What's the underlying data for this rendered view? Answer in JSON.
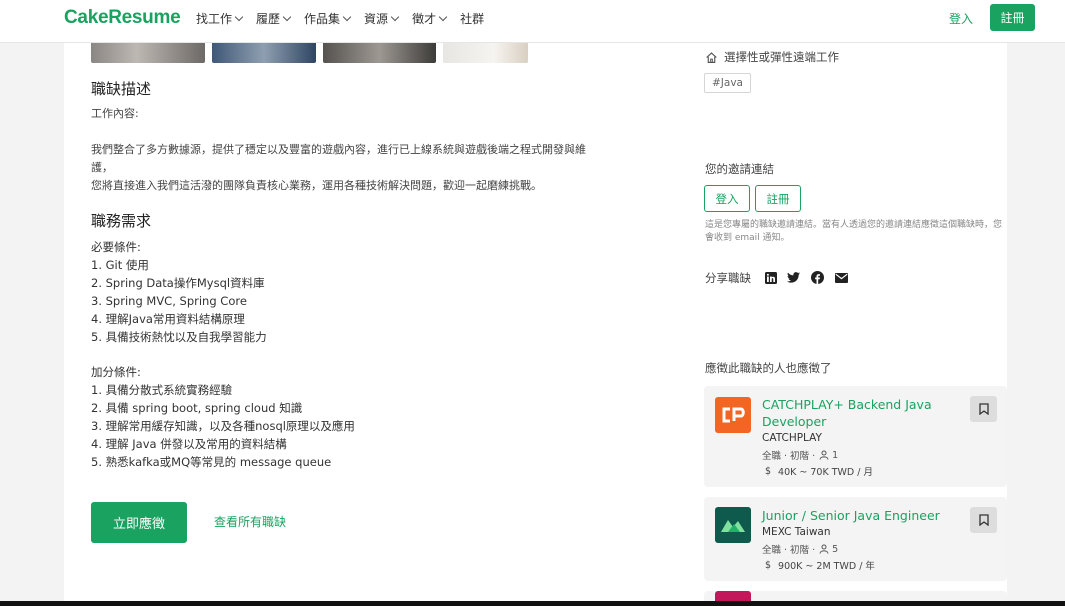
{
  "header": {
    "logo": "CakeResume",
    "nav": [
      {
        "label": "找工作",
        "has_menu": true
      },
      {
        "label": "履歷",
        "has_menu": true
      },
      {
        "label": "作品集",
        "has_menu": true
      },
      {
        "label": "資源",
        "has_menu": true
      },
      {
        "label": "徵才",
        "has_menu": true
      },
      {
        "label": "社群",
        "has_menu": false
      }
    ],
    "login": "登入",
    "register": "註冊"
  },
  "description": {
    "heading": "職缺描述",
    "intro": "工作內容:",
    "lines": [
      "我們整合了多方數據源，提供了穩定以及豐富的遊戲內容，進行已上線系統與遊戲後端之程式開發與維",
      "護，",
      "您將直接進入我們這活潑的團隊負責核心業務，運用各種技術解決問題，歡迎一起磨練挑戰。"
    ]
  },
  "requirements": {
    "heading": "職務需求",
    "required_title": "必要條件:",
    "required": [
      "1. Git 使用",
      "2. Spring Data操作Mysql資料庫",
      "3. Spring MVC, Spring Core",
      "4. 理解Java常用資料結構原理",
      "5. 具備技術熱忱以及自我學習能力"
    ],
    "bonus_title": "加分條件:",
    "bonus": [
      "1. 具備分散式系統實務經驗",
      "2. 具備 spring boot, spring cloud 知識",
      "3. 理解常用緩存知識，以及各種nosql原理以及應用",
      "4. 理解 Java 併發以及常用的資料結構",
      "5. 熟悉kafka或MQ等常見的 message queue"
    ]
  },
  "actions": {
    "apply": "立即應徵",
    "all_jobs": "查看所有職缺"
  },
  "sidebar": {
    "remote": "選擇性或彈性遠端工作",
    "tag": "#Java",
    "invite_title": "您的邀請連結",
    "invite_login": "登入",
    "invite_register": "註冊",
    "invite_note": "這是您專屬的職缺邀請連結。當有人透過您的邀請連結應徵這個職缺時，您會收到 email 通知。",
    "share_label": "分享職缺",
    "share_icons": [
      "linkedin-icon",
      "twitter-icon",
      "facebook-icon",
      "email-icon"
    ],
    "also_title": "應徵此職缺的人也應徵了",
    "jobs": [
      {
        "title": "CATCHPLAY+ Backend Java Developer",
        "company": "CATCHPLAY",
        "type": "全職 · 初階 ·",
        "openings": "1",
        "salary": "40K ~ 70K TWD / 月",
        "logo_color": "#f26522"
      },
      {
        "title": "Junior / Senior Java Engineer",
        "company": "MEXC Taiwan",
        "type": "全職 · 初階 ·",
        "openings": "5",
        "salary": "900K ~ 2M TWD / 年",
        "logo_color": "#0e5a4c"
      }
    ]
  },
  "colors": {
    "brand": "#1aa260",
    "background": "#f3f3f3"
  }
}
